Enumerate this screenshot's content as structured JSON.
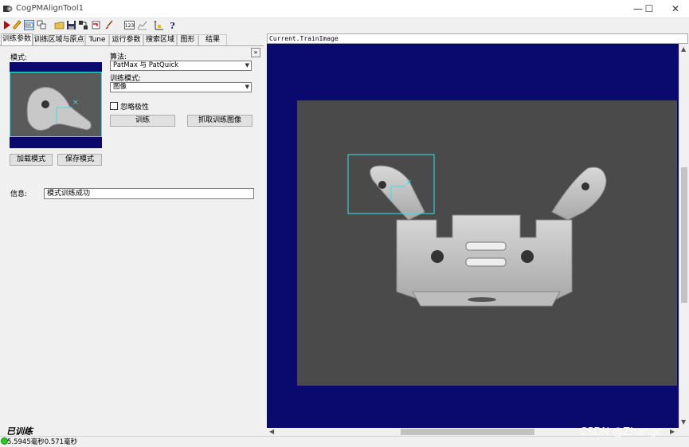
{
  "window": {
    "title": "CogPMAlignTool1",
    "minimize": "—",
    "maximize": "☐",
    "close": "✕"
  },
  "toolbar": {
    "icons": [
      "run-icon",
      "edit-icon",
      "display-icon",
      "copy-icon",
      "open-icon",
      "save-icon",
      "link-icon",
      "undo-icon",
      "brush-icon",
      "numeric-icon",
      "graph-icon",
      "calibrate-icon",
      "help-icon"
    ]
  },
  "tabs": [
    "训练参数",
    "训练区域与原点",
    "Tune",
    "运行参数",
    "搜索区域",
    "图形",
    "结果"
  ],
  "train_params": {
    "pattern_label": "模式:",
    "algorithm_label": "算法:",
    "algorithm_value": "PatMax 与 PatQuick",
    "train_mode_label": "训练模式:",
    "train_mode_value": "图像",
    "ignore_polarity_label": "忽略极性",
    "ignore_polarity_checked": false,
    "train_button": "训练",
    "grab_button": "抓取训练图像",
    "load_button": "加载模式",
    "save_button": "保存模式",
    "info_label": "信息:",
    "info_value": "模式训练成功",
    "collapse": "»"
  },
  "status": {
    "trained": "已训练",
    "time": "5.5945毫秒0.571毫秒",
    "led_color": "#22cc22"
  },
  "display": {
    "header": "Current.TrainImage",
    "background": "#0a0a6e",
    "roi_color": "#2ee6e6"
  },
  "watermark": "CSDN @Zhangc"
}
